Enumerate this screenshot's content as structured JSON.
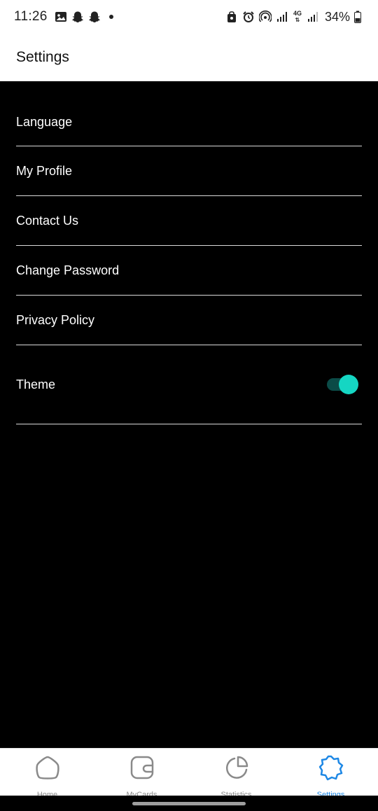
{
  "status_bar": {
    "time": "11:26",
    "battery_percent": "34%",
    "network_label": "4G",
    "left_icons": [
      "gallery-icon",
      "snapchat-icon",
      "snapchat-icon",
      "notification-dot"
    ],
    "right_icons": [
      "lock-icon",
      "alarm-icon",
      "hotspot-icon",
      "signal-icon",
      "4g-icon",
      "signal-icon",
      "battery-icon"
    ]
  },
  "app_bar": {
    "title": "Settings"
  },
  "settings": {
    "items": [
      {
        "label": "Language"
      },
      {
        "label": "My Profile"
      },
      {
        "label": "Contact Us"
      },
      {
        "label": "Change Password"
      },
      {
        "label": "Privacy Policy"
      }
    ],
    "theme": {
      "label": "Theme",
      "enabled": true
    }
  },
  "bottom_nav": {
    "items": [
      {
        "label": "Home",
        "icon": "home-icon",
        "active": false
      },
      {
        "label": "MyCards",
        "icon": "wallet-icon",
        "active": false
      },
      {
        "label": "Statistics",
        "icon": "pie-chart-icon",
        "active": false
      },
      {
        "label": "Settings",
        "icon": "gear-icon",
        "active": true
      }
    ]
  },
  "colors": {
    "background": "#000000",
    "toggle_thumb": "#15d6c3",
    "toggle_track": "#0b4b47",
    "active_tab": "#1e88e5",
    "inactive_tab": "#8a8a8a"
  }
}
